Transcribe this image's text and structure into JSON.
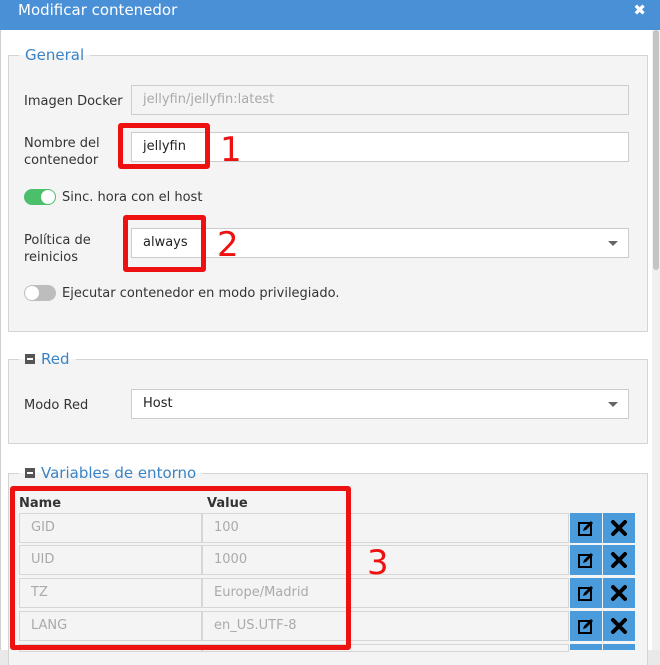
{
  "dialog": {
    "title": "Modificar contenedor",
    "close_icon": "close-icon"
  },
  "general": {
    "legend": "General",
    "image_label": "Imagen Docker",
    "image_value": "jellyfin/jellyfin:latest",
    "name_label_line1": "Nombre del",
    "name_label_line2": "contenedor",
    "name_value": "jellyfin",
    "sync_time_label": "Sinc. hora con el host",
    "sync_time_on": true,
    "restart_label_line1": "Política de",
    "restart_label_line2": "reinicios",
    "restart_value": "always",
    "privileged_label": "Ejecutar contenedor en modo privilegiado.",
    "privileged_on": false
  },
  "network": {
    "legend": "Red",
    "mode_label": "Modo Red",
    "mode_value": "Host"
  },
  "env": {
    "legend": "Variables de entorno",
    "headers": {
      "name": "Name",
      "value": "Value"
    },
    "rows": [
      {
        "name": "GID",
        "value": "100"
      },
      {
        "name": "UID",
        "value": "1000"
      },
      {
        "name": "TZ",
        "value": "Europe/Madrid"
      },
      {
        "name": "LANG",
        "value": "en_US.UTF-8"
      }
    ]
  },
  "annotations": {
    "one": "1",
    "two": "2",
    "three": "3",
    "color": "#ee1111"
  },
  "colors": {
    "titlebar": "#4a90d6",
    "legend": "#3b83c5",
    "toggle_on": "#4cbf6a",
    "icon_button": "#4a9bdc"
  }
}
